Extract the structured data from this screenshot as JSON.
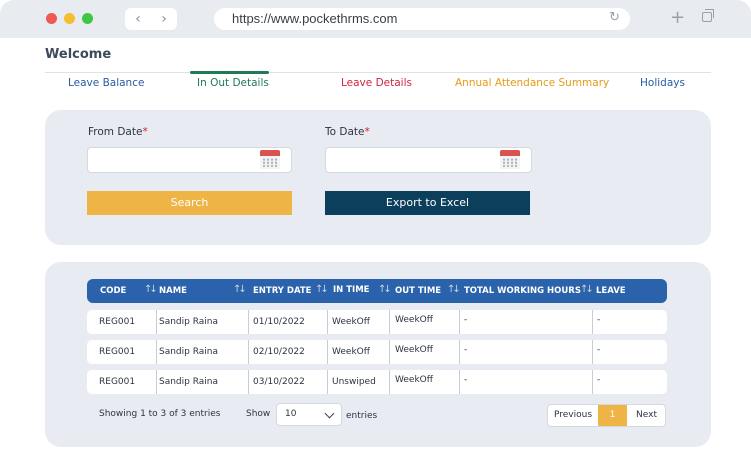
{
  "browser": {
    "url": "https://www.pockethrms.com",
    "back": "‹",
    "forward": "›",
    "reload": "↻",
    "new_tab": "+"
  },
  "page": {
    "title": "Welcome"
  },
  "tabs": [
    {
      "label": "Leave Balance",
      "color": "#2a5aa0"
    },
    {
      "label": "In Out Details",
      "color": "#1f7a55",
      "active": true
    },
    {
      "label": "Leave Details",
      "color": "#d0253f"
    },
    {
      "label": "Annual Attendance Summary",
      "color": "#e79a19"
    },
    {
      "label": "Holidays",
      "color": "#2a5aa0"
    }
  ],
  "filter": {
    "from_label": "From Date",
    "to_label": "To Date",
    "required_mark": "*",
    "from_value": "",
    "to_value": "",
    "search_label": "Search",
    "export_label": "Export to Excel"
  },
  "table": {
    "columns": [
      "CODE",
      "NAME",
      "ENTRY DATE",
      "IN TIME",
      "OUT TIME",
      "TOTAL WORKING HOURS",
      "LEAVE"
    ],
    "sort_glyph": "↑↓",
    "rows": [
      [
        "REG001",
        "Sandip Raina",
        "01/10/2022",
        "WeekOff",
        "WeekOff",
        "-",
        "-"
      ],
      [
        "REG001",
        "Sandip Raina",
        "02/10/2022",
        "WeekOff",
        "WeekOff",
        "-",
        "-"
      ],
      [
        "REG001",
        "Sandip Raina",
        "03/10/2022",
        "Unswiped",
        "WeekOff",
        "-",
        "-"
      ]
    ]
  },
  "footer": {
    "info": "Showing 1 to 3 of 3 entries",
    "show_label": "Show",
    "page_size": "10",
    "entries_label": "entries",
    "prev": "Previous",
    "current_page": "1",
    "next": "Next"
  },
  "colors": {
    "accent_search": "#efb446",
    "accent_export": "#0b3f5c",
    "table_header": "#2a63ac"
  }
}
